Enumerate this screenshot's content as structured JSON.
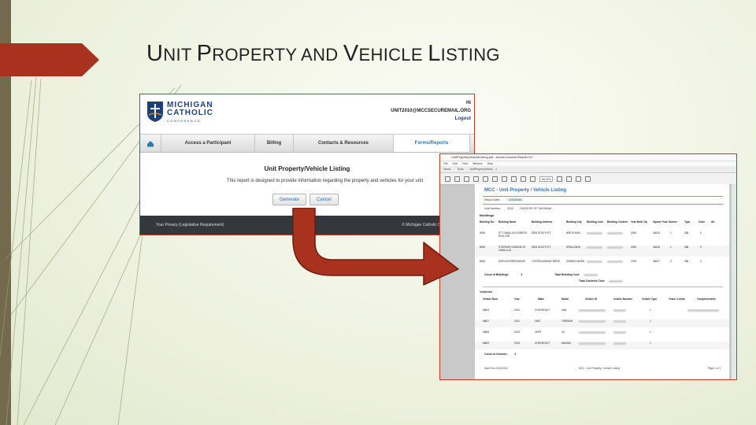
{
  "slide": {
    "title": "UNIT PROPERTY AND VEHICLE LISTING",
    "title_parts": [
      {
        "cap": "U",
        "rest": "NIT "
      },
      {
        "cap": "P",
        "rest": "ROPERTY AND "
      },
      {
        "cap": "V",
        "rest": "EHICLE "
      },
      {
        "cap": "L",
        "rest": "ISTING"
      }
    ],
    "accent_color": "#a8321e",
    "sidebar_color": "#736a4e"
  },
  "portal": {
    "logo": {
      "line1": "MICHIGAN",
      "line2": "CATHOLIC",
      "line3": "CONFERENCE"
    },
    "user": {
      "greeting": "Hi",
      "email": "UNIT2010@MCCSECUREMAIL.ORG",
      "logout": "Logout"
    },
    "nav": [
      {
        "label": "Access a Participant"
      },
      {
        "label": "Billing"
      },
      {
        "label": "Contacts & Resources"
      },
      {
        "label": "Forms/Reports"
      }
    ],
    "page_title": "Unit Property/Vehicle Listing",
    "description": "This report is designed to provide information regarding the property and vehicles for your unit",
    "buttons": {
      "generate": "Generate",
      "cancel": "Cancel"
    },
    "footer": {
      "left": "Your Privacy (Legislative Requirement)",
      "right": "© Michigan Catholic Conference"
    }
  },
  "report": {
    "window_title": "UnitPropertyVehicleListing.pdf - Adobe Acrobat Reader DC",
    "menu": [
      "File",
      "Edit",
      "View",
      "Window",
      "Help"
    ],
    "tabs": [
      "Home",
      "Tools",
      "UnitPropertyVehicl... ×"
    ],
    "zoom": "96.5%",
    "title": "MCC - Unit Property / Vehicle Listing",
    "report_date_label": "Report Date:",
    "report_date": "4/13/2016",
    "unit_label": "Unit Number:",
    "unit_number": "2010",
    "unit_name": "DIOCESE OF SAGINAW",
    "buildings_heading": "Buildings",
    "building_columns": [
      "Building No.",
      "Building Name",
      "Building Address",
      "Building City",
      "Building Cost",
      "Building Content",
      "Year Built",
      "Zip",
      "Square Foot",
      "Stories",
      "Type",
      "Code",
      "Alt"
    ],
    "buildings": [
      {
        "no": "8926",
        "name": "ST. CAMILLUS IN BIRCH RUN CHE",
        "addr": "5206 SOUTH ST.",
        "city": "BIRCH RUN",
        "year": "2006",
        "zip": "48415",
        "stories": "1",
        "type": "286",
        "code": "0"
      },
      {
        "no": "8926",
        "name": "STORAGE GARAGE AT CAMILLUS",
        "addr": "5206 SOUTH ST.",
        "city": "SPAULDING",
        "year": "2006",
        "zip": "48415",
        "stories": "1",
        "type": "286",
        "code": "0"
      },
      {
        "no": "8926",
        "name": "DISPLAY/PARSONAGE",
        "addr": "4 ROSELANDING DRIVE",
        "city": "GRAND HAVEN",
        "year": "1978",
        "zip": "48417",
        "stories": "2",
        "type": "286",
        "code": "0"
      }
    ],
    "building_totals": {
      "count_label": "Count of Buildings:",
      "count": "3",
      "cost_label": "Total Building Cost:",
      "content_label": "Total Contents Cost:"
    },
    "vehicles_heading": "Vehicles",
    "vehicle_columns": [
      "Vehicle Num.",
      "Year",
      "Make",
      "Model",
      "Vehicle ID",
      "Vehicle Number",
      "Vehicle Type",
      "Years / Limits",
      "Comprehensive"
    ],
    "vehicles": [
      {
        "num": "M803",
        "year": "2010",
        "make": "CHEVROLET",
        "model": "VAN",
        "type": "1"
      },
      {
        "num": "M807",
        "year": "2011",
        "make": "GMC",
        "model": "TERRAIN",
        "type": "1"
      },
      {
        "num": "M808",
        "year": "2013",
        "make": "JEEP",
        "model": "4X",
        "type": "1"
      },
      {
        "num": "M809",
        "year": "2013",
        "make": "CHEVROLET",
        "model": "MALIBU",
        "type": "1"
      }
    ],
    "vehicle_totals": {
      "count_label": "Count of Vehicles:",
      "count": "4"
    },
    "footer": {
      "left": "Date Run: 4/13/2016",
      "middle": "MCC - Unit Property / Vehicle Listing",
      "right": "Page 1 of 1"
    }
  }
}
